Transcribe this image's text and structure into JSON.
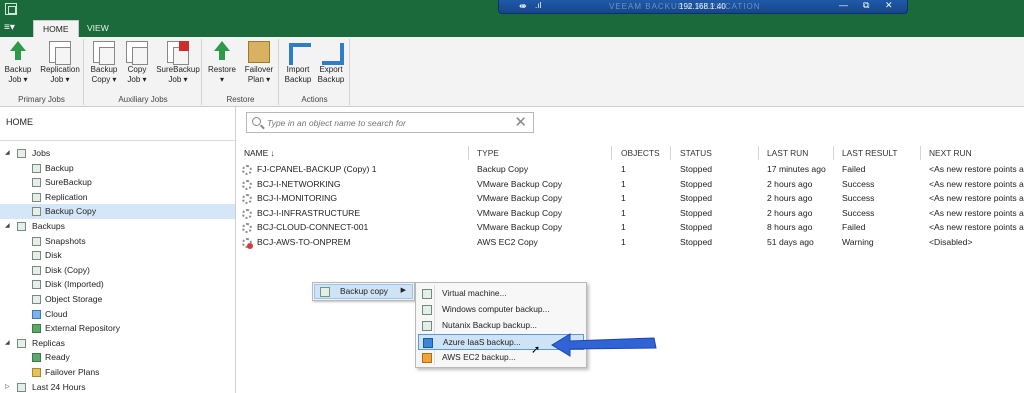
{
  "titlebar": {
    "remote_faded_title": "VEEAM BACKUP & REPLICATION",
    "remote_ip": "192.168.1.40",
    "pin_icon": "pin-icon",
    "signal_icon": "signal-icon",
    "minimize": "—",
    "restore": "⧉",
    "close": "✕"
  },
  "menu": {
    "button": "≡▾"
  },
  "tabs": [
    {
      "label": "HOME",
      "active": true
    },
    {
      "label": "VIEW",
      "active": false
    }
  ],
  "ribbon": {
    "groups": [
      {
        "title": "Primary Jobs",
        "buttons": [
          {
            "line1": "Backup",
            "line2": "Job ▾",
            "icon": "backup-job-icon"
          },
          {
            "line1": "Replication",
            "line2": "Job ▾",
            "icon": "replication-job-icon"
          }
        ]
      },
      {
        "title": "Auxiliary Jobs",
        "buttons": [
          {
            "line1": "Backup",
            "line2": "Copy ▾",
            "icon": "backup-copy-icon"
          },
          {
            "line1": "Copy",
            "line2": "Job ▾",
            "icon": "copy-job-icon"
          },
          {
            "line1": "SureBackup",
            "line2": "Job ▾",
            "icon": "surebackup-job-icon"
          }
        ]
      },
      {
        "title": "Restore",
        "buttons": [
          {
            "line1": "Restore",
            "line2": "▾",
            "icon": "restore-icon"
          },
          {
            "line1": "Failover",
            "line2": "Plan ▾",
            "icon": "failover-plan-icon"
          }
        ]
      },
      {
        "title": "Actions",
        "buttons": [
          {
            "line1": "Import",
            "line2": "Backup",
            "icon": "import-backup-icon"
          },
          {
            "line1": "Export",
            "line2": "Backup",
            "icon": "export-backup-icon"
          }
        ]
      }
    ]
  },
  "nav": {
    "home_label": "HOME",
    "tree": [
      {
        "label": "Jobs",
        "level": 0,
        "expanded": true,
        "icon": "jobs-icon"
      },
      {
        "label": "Backup",
        "level": 1,
        "icon": "backup-job-icon"
      },
      {
        "label": "SureBackup",
        "level": 1,
        "icon": "surebackup-icon"
      },
      {
        "label": "Replication",
        "level": 1,
        "icon": "replication-icon"
      },
      {
        "label": "Backup Copy",
        "level": 1,
        "icon": "backup-copy-icon",
        "selected": true
      },
      {
        "label": "Backups",
        "level": 0,
        "expanded": true,
        "icon": "backups-icon"
      },
      {
        "label": "Snapshots",
        "level": 1,
        "icon": "snapshots-icon"
      },
      {
        "label": "Disk",
        "level": 1,
        "icon": "disk-icon"
      },
      {
        "label": "Disk (Copy)",
        "level": 1,
        "icon": "disk-copy-icon"
      },
      {
        "label": "Disk (Imported)",
        "level": 1,
        "icon": "disk-imported-icon"
      },
      {
        "label": "Object Storage",
        "level": 1,
        "icon": "object-storage-icon"
      },
      {
        "label": "Cloud",
        "level": 1,
        "icon": "cloud-icon"
      },
      {
        "label": "External Repository",
        "level": 1,
        "icon": "external-repository-icon"
      },
      {
        "label": "Replicas",
        "level": 0,
        "expanded": true,
        "icon": "replicas-icon"
      },
      {
        "label": "Ready",
        "level": 1,
        "icon": "ready-icon"
      },
      {
        "label": "Failover Plans",
        "level": 1,
        "icon": "failover-plans-icon"
      },
      {
        "label": "Last 24 Hours",
        "level": 0,
        "expanded": false,
        "icon": "last-24-hours-icon"
      }
    ]
  },
  "search": {
    "placeholder": "Type in an object name to search for",
    "clear": "✕"
  },
  "table": {
    "columns": [
      "NAME ↓",
      "TYPE",
      "OBJECTS",
      "STATUS",
      "LAST RUN",
      "LAST RESULT",
      "NEXT RUN"
    ],
    "rows": [
      {
        "name": "FJ-CPANEL-BACKUP (Copy) 1",
        "type": "Backup Copy",
        "objects": "1",
        "status": "Stopped",
        "last_run": "17 minutes ago",
        "last_result": "Failed",
        "next_run": "<As new restore points a"
      },
      {
        "name": "BCJ-I-NETWORKING",
        "type": "VMware Backup Copy",
        "objects": "1",
        "status": "Stopped",
        "last_run": "2 hours ago",
        "last_result": "Success",
        "next_run": "<As new restore points a"
      },
      {
        "name": "BCJ-I-MONITORING",
        "type": "VMware Backup Copy",
        "objects": "1",
        "status": "Stopped",
        "last_run": "2 hours ago",
        "last_result": "Success",
        "next_run": "<As new restore points a"
      },
      {
        "name": "BCJ-I-INFRASTRUCTURE",
        "type": "VMware Backup Copy",
        "objects": "1",
        "status": "Stopped",
        "last_run": "2 hours ago",
        "last_result": "Success",
        "next_run": "<As new restore points a"
      },
      {
        "name": "BCJ-CLOUD-CONNECT-001",
        "type": "VMware Backup Copy",
        "objects": "1",
        "status": "Stopped",
        "last_run": "8 hours ago",
        "last_result": "Failed",
        "next_run": "<As new restore points a"
      },
      {
        "name": "BCJ-AWS-TO-ONPREM",
        "type": "AWS EC2 Copy",
        "objects": "1",
        "status": "Stopped",
        "last_run": "51 days ago",
        "last_result": "Warning",
        "next_run": "<Disabled>"
      }
    ]
  },
  "context_menu": {
    "parent_item": "Backup copy",
    "parent_arrow": "▶",
    "submenu": [
      {
        "label": "Virtual machine...",
        "icon": "virtual-machine-icon"
      },
      {
        "label": "Windows computer backup...",
        "icon": "windows-computer-icon"
      },
      {
        "label": "Nutanix Backup backup...",
        "icon": "nutanix-icon"
      },
      {
        "label": "Azure IaaS backup...",
        "icon": "azure-icon",
        "highlighted": true
      },
      {
        "label": "AWS EC2 backup...",
        "icon": "aws-icon"
      }
    ]
  },
  "colors": {
    "title_green": "#1b6a3b",
    "remote_blue": "#1f5aa8",
    "selection_blue": "#d5e6f8",
    "annotation_arrow": "#2f63d6"
  }
}
